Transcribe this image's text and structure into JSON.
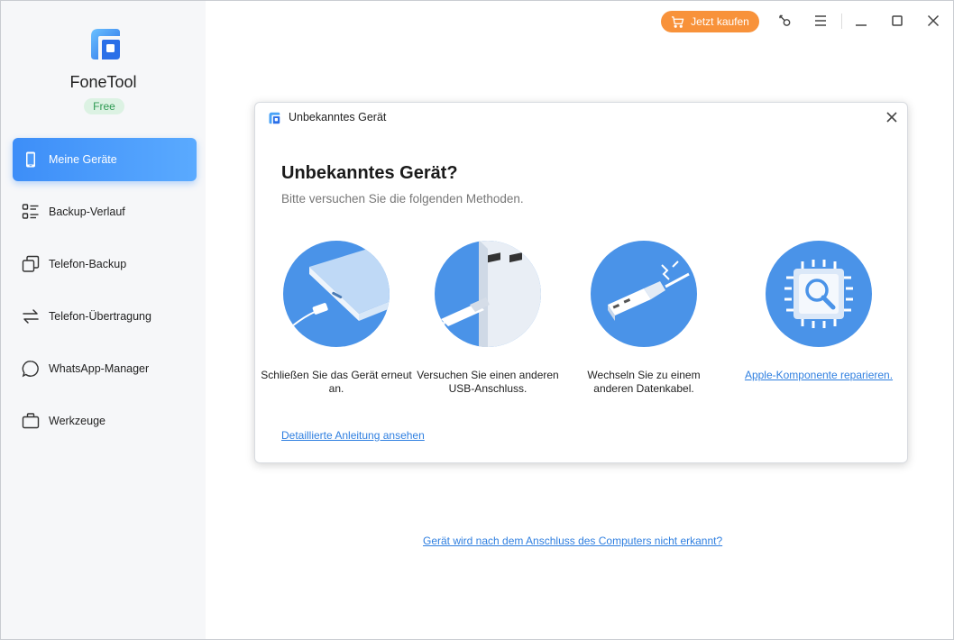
{
  "app": {
    "name": "FoneTool",
    "badge": "Free"
  },
  "sidebar": {
    "items": [
      {
        "label": "Meine Geräte",
        "icon": "phone-icon",
        "active": true
      },
      {
        "label": "Backup-Verlauf",
        "icon": "list-icon",
        "active": false
      },
      {
        "label": "Telefon-Backup",
        "icon": "copy-icon",
        "active": false
      },
      {
        "label": "Telefon-Übertragung",
        "icon": "transfer-arrows-icon",
        "active": false
      },
      {
        "label": "WhatsApp-Manager",
        "icon": "chat-bubble-icon",
        "active": false
      },
      {
        "label": "Werkzeuge",
        "icon": "toolbox-icon",
        "active": false
      }
    ]
  },
  "titlebar": {
    "buy_label": "Jetzt kaufen"
  },
  "dialog": {
    "window_title": "Unbekanntes Gerät",
    "heading": "Unbekanntes Gerät?",
    "subheading": "Bitte versuchen Sie die folgenden Methoden.",
    "methods": [
      {
        "caption": "Schließen Sie das Gerät erneut an.",
        "icon": "reconnect-phone-icon",
        "link": false
      },
      {
        "caption": "Versuchen Sie einen anderen USB-Anschluss.",
        "icon": "usb-port-icon",
        "link": false
      },
      {
        "caption": "Wechseln Sie zu einem anderen Datenkabel.",
        "icon": "usb-cable-icon",
        "link": false
      },
      {
        "caption": "Apple-Komponente reparieren.",
        "icon": "chip-repair-icon",
        "link": true
      }
    ],
    "guide_link": "Detaillierte Anleitung ansehen"
  },
  "help_link": "Gerät wird nach dem Anschluss des Computers nicht erkannt?",
  "colors": {
    "accent": "#3d8ef8",
    "buy": "#f8923a",
    "link": "#2f7fe0",
    "badge_bg": "#dcf2e3",
    "badge_text": "#2f9a53",
    "circle": "#4a93e8"
  }
}
